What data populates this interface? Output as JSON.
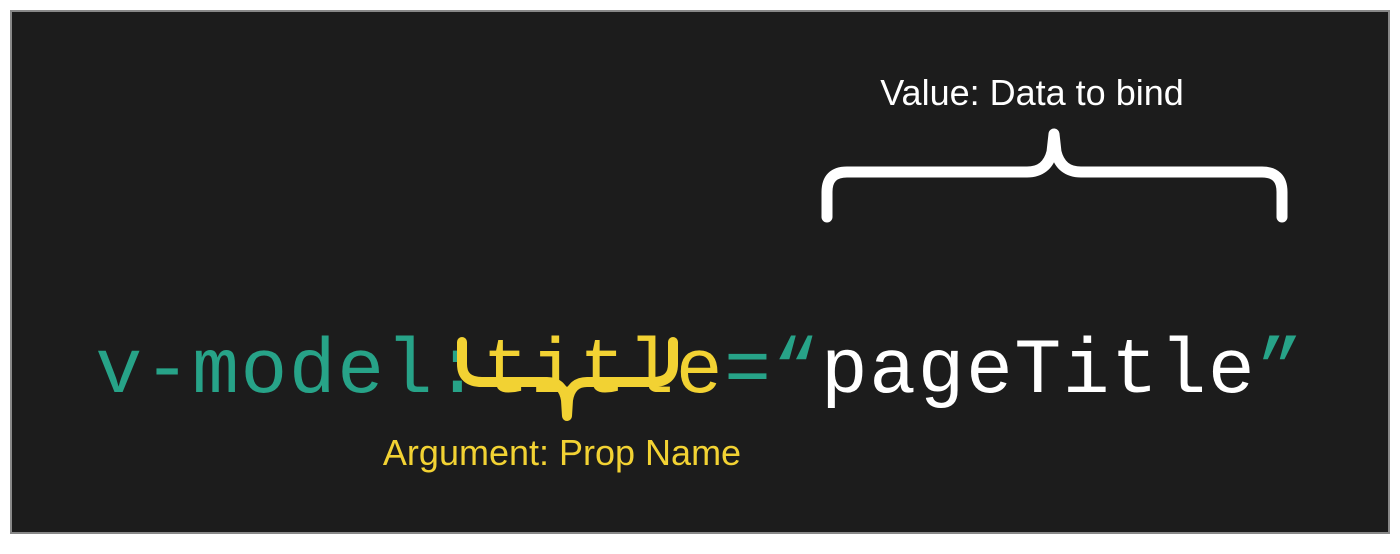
{
  "code": {
    "directive": "v-model",
    "colon": ":",
    "argument": "title",
    "equals": "=",
    "open_quote": "“",
    "value": "pageTitle",
    "close_quote": "”"
  },
  "annotations": {
    "value_label": "Value: Data to bind",
    "argument_label": "Argument: Prop Name"
  },
  "colors": {
    "teal": "#27a388",
    "yellow": "#f2d233",
    "white": "#ffffff",
    "bg": "#1c1c1c"
  }
}
